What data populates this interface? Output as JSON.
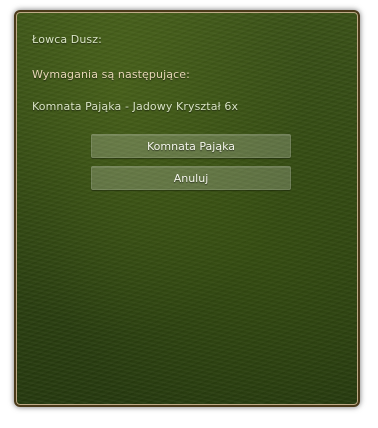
{
  "dialog": {
    "title": "Łowca Dusz:",
    "requirements_heading": "Wymagania są następujące:",
    "requirement_item": "Komnata Pająka - Jadowy Kryształ 6x",
    "buttons": {
      "primary_label": "Komnata Pająka",
      "cancel_label": "Anuluj"
    }
  },
  "colors": {
    "panel_background": "#2f4512",
    "panel_border": "#4a3a1a",
    "text": "#d8e3c3",
    "button_background": "rgba(255,255,255,0.20)"
  }
}
